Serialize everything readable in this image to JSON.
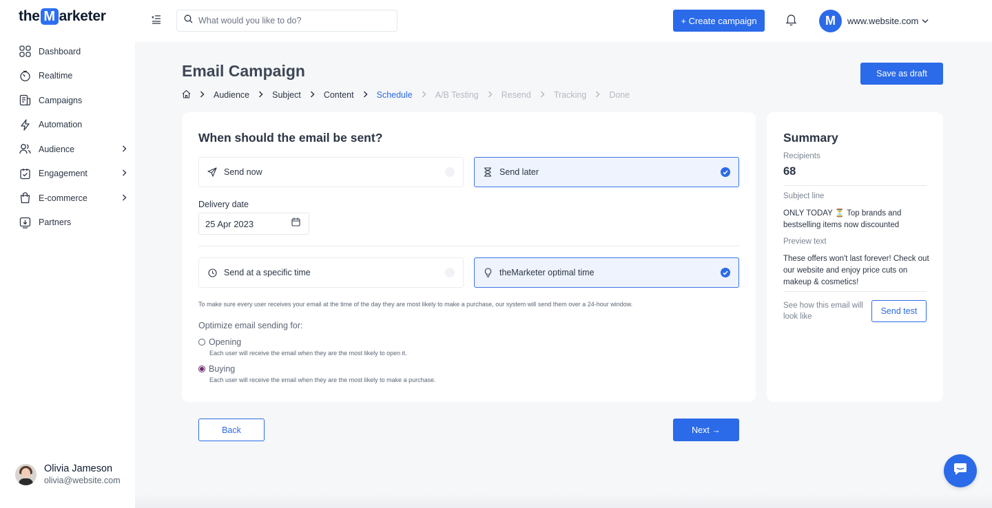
{
  "brand": {
    "logo_prefix": "the",
    "logo_m": "M",
    "logo_suffix": "arketer",
    "accent": "#2b6ae8"
  },
  "sidebar": {
    "items": [
      {
        "label": "Dashboard",
        "icon": "dashboard-icon",
        "has_children": false
      },
      {
        "label": "Realtime",
        "icon": "realtime-icon",
        "has_children": false
      },
      {
        "label": "Campaigns",
        "icon": "campaigns-icon",
        "has_children": false
      },
      {
        "label": "Automation",
        "icon": "automation-icon",
        "has_children": false
      },
      {
        "label": "Audience",
        "icon": "audience-icon",
        "has_children": true
      },
      {
        "label": "Engagement",
        "icon": "engagement-icon",
        "has_children": true
      },
      {
        "label": "E-commerce",
        "icon": "ecommerce-icon",
        "has_children": true
      },
      {
        "label": "Partners",
        "icon": "partners-icon",
        "has_children": false
      }
    ],
    "user": {
      "name": "Olivia Jameson",
      "email": "olivia@website.com"
    }
  },
  "topbar": {
    "search_placeholder": "What would you like to do?",
    "create_label": "+ Create campaign",
    "site_initial": "M",
    "site_name": "www.website.com"
  },
  "header": {
    "title": "Email Campaign",
    "save_draft_label": "Save as draft",
    "breadcrumb": [
      {
        "label": "Audience",
        "state": "done"
      },
      {
        "label": "Subject",
        "state": "done"
      },
      {
        "label": "Content",
        "state": "done"
      },
      {
        "label": "Schedule",
        "state": "active"
      },
      {
        "label": "A/B Testing",
        "state": "pending"
      },
      {
        "label": "Resend",
        "state": "pending"
      },
      {
        "label": "Tracking",
        "state": "pending"
      },
      {
        "label": "Done",
        "state": "pending"
      }
    ]
  },
  "schedule": {
    "title": "When should the email be sent?",
    "send_now_label": "Send now",
    "send_later_label": "Send later",
    "send_later_selected": true,
    "delivery_date_label": "Delivery date",
    "delivery_date_value": "25 Apr 2023",
    "specific_time_label": "Send at a specific time",
    "optimal_time_label": "theMarketer optimal time",
    "optimal_selected": true,
    "note": "To make sure every user receives your email at the time of the day they are most likely to make a purchase, our system will send them over a 24-hour window.",
    "optimize_title": "Optimize email sending for:",
    "opening_label": "Opening",
    "opening_desc": "Each user will receive the email when they are the most likely to open it.",
    "buying_label": "Buying",
    "buying_desc": "Each user will receive the email when they are the most likely to make a purchase.",
    "selected_optimization": "Buying"
  },
  "nav_buttons": {
    "back_label": "Back",
    "next_label": "Next →"
  },
  "summary": {
    "title": "Summary",
    "recipients_label": "Recipients",
    "recipients_count": "68",
    "subject_label": "Subject line",
    "subject_text": "ONLY TODAY ⏳ Top brands and bestselling items now discounted",
    "preview_label": "Preview text",
    "preview_text": "These offers won't last forever! Check out our website and enjoy price cuts on makeup & cosmetics!",
    "see_how_text": "See how this email will look like",
    "send_test_label": "Send test"
  }
}
